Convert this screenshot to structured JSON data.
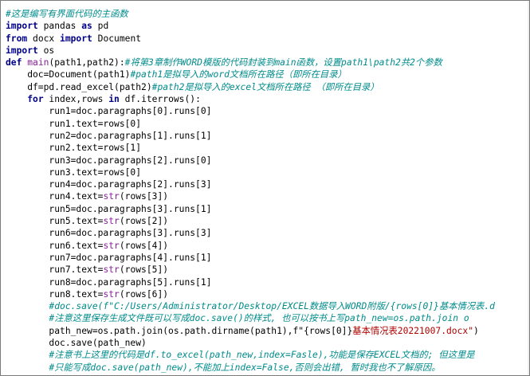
{
  "editor": {
    "lines": [
      [
        {
          "t": "#这是编写有界面代码的主函数",
          "c": "cm"
        }
      ],
      [
        {
          "t": "import",
          "c": "kw"
        },
        {
          "t": " pandas ",
          "c": "op"
        },
        {
          "t": "as",
          "c": "kw"
        },
        {
          "t": " pd",
          "c": "op"
        }
      ],
      [
        {
          "t": "from",
          "c": "kw"
        },
        {
          "t": " docx ",
          "c": "op"
        },
        {
          "t": "import",
          "c": "kw"
        },
        {
          "t": " Document",
          "c": "op"
        }
      ],
      [
        {
          "t": "import",
          "c": "kw"
        },
        {
          "t": " os",
          "c": "op"
        }
      ],
      [
        {
          "t": "def",
          "c": "kw"
        },
        {
          "t": " ",
          "c": "op"
        },
        {
          "t": "main",
          "c": "mk"
        },
        {
          "t": "(path1,path2):",
          "c": "op"
        },
        {
          "t": "#将第3章制作WORD模版的代码封装到main函数，设置path1\\path2共2个参数",
          "c": "cm"
        }
      ],
      [
        {
          "t": "    doc=Document(path1)",
          "c": "op"
        },
        {
          "t": "#path1是拟导入的word文档所在路径（即所在目录）",
          "c": "cm"
        }
      ],
      [
        {
          "t": "    df=pd.read_excel(path2)",
          "c": "op"
        },
        {
          "t": "#path2是拟导入的excel文档所在路径 （即所在目录）",
          "c": "cm"
        }
      ],
      [
        {
          "t": "    ",
          "c": "op"
        },
        {
          "t": "for",
          "c": "kw"
        },
        {
          "t": " index,rows ",
          "c": "op"
        },
        {
          "t": "in",
          "c": "kw"
        },
        {
          "t": " df.iterrows():",
          "c": "op"
        }
      ],
      [
        {
          "t": "        run1=doc.paragraphs[0].runs[0]",
          "c": "op"
        }
      ],
      [
        {
          "t": "        run1.text=rows[0]",
          "c": "op"
        }
      ],
      [
        {
          "t": "        run2=doc.paragraphs[1].runs[1]",
          "c": "op"
        }
      ],
      [
        {
          "t": "        run2.text=rows[1]",
          "c": "op"
        }
      ],
      [
        {
          "t": "        run3=doc.paragraphs[2].runs[0]",
          "c": "op"
        }
      ],
      [
        {
          "t": "        run3.text=rows[0]",
          "c": "op"
        }
      ],
      [
        {
          "t": "        run4=doc.paragraphs[2].runs[3]",
          "c": "op"
        }
      ],
      [
        {
          "t": "        run4.text=",
          "c": "op"
        },
        {
          "t": "str",
          "c": "bi"
        },
        {
          "t": "(rows[3])",
          "c": "op"
        }
      ],
      [
        {
          "t": "        run5=doc.paragraphs[3].runs[1]",
          "c": "op"
        }
      ],
      [
        {
          "t": "        run5.text=",
          "c": "op"
        },
        {
          "t": "str",
          "c": "bi"
        },
        {
          "t": "(rows[2])",
          "c": "op"
        }
      ],
      [
        {
          "t": "        run6=doc.paragraphs[3].runs[3]",
          "c": "op"
        }
      ],
      [
        {
          "t": "        run6.text=",
          "c": "op"
        },
        {
          "t": "str",
          "c": "bi"
        },
        {
          "t": "(rows[4])",
          "c": "op"
        }
      ],
      [
        {
          "t": "        run7=doc.paragraphs[4].runs[1]",
          "c": "op"
        }
      ],
      [
        {
          "t": "        run7.text=",
          "c": "op"
        },
        {
          "t": "str",
          "c": "bi"
        },
        {
          "t": "(rows[5])",
          "c": "op"
        }
      ],
      [
        {
          "t": "        run8=doc.paragraphs[5].runs[1]",
          "c": "op"
        }
      ],
      [
        {
          "t": "        run8.text=",
          "c": "op"
        },
        {
          "t": "str",
          "c": "bi"
        },
        {
          "t": "(rows[6])",
          "c": "op"
        }
      ],
      [
        {
          "t": "        #doc.save(f\"C:/Users/Administrator/Desktop/EXCEL数据导入WORD附版/{rows[0]}基本情况表.d",
          "c": "cm"
        }
      ],
      [
        {
          "t": "        #注意这里保存生成文件既可以写成doc.save()的样式, 也可以按书上写path_new=os.path.join o",
          "c": "cm"
        }
      ],
      [
        {
          "t": "        path_new=os.path.join(os.path.dirname(path1),f\"",
          "c": "op"
        },
        {
          "t": "{rows[0]}",
          "c": "op"
        },
        {
          "t": "基本情况表20221007.docx\"",
          "c": "st"
        },
        {
          "t": ")",
          "c": "op"
        }
      ],
      [
        {
          "t": "        doc.save(path_new)",
          "c": "op"
        }
      ],
      [
        {
          "t": "        #注意书上这里的代码是df.to_excel(path_new,index=Fasle),功能是保存EXCEL文档的; 但这里是",
          "c": "cm"
        }
      ],
      [
        {
          "t": "        #只能写成doc.save(path_new),不能加上index=False,否则会出错, 暂时我也不了解原因。",
          "c": "cm"
        }
      ]
    ]
  },
  "colors": {
    "keyword": "#00008b",
    "comment": "#008b8b",
    "builtin": "#8a1e9c",
    "string": "#b00000",
    "text": "#000000",
    "border": "#7a7a7a"
  }
}
